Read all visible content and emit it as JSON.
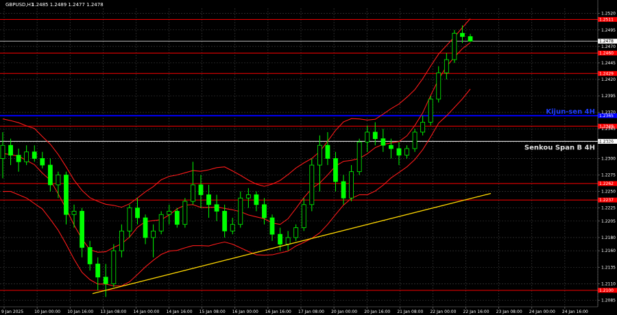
{
  "header": {
    "symbol": "GBPUSD,H1",
    "ohlc": "1.2485 1.2489 1.2477 1.2478"
  },
  "chart_data": {
    "type": "candlestick",
    "symbol": "GBPUSD",
    "timeframe": "H1",
    "ylim": [
      1.2075,
      1.2528
    ],
    "y_ticks": [
      "1.2520",
      "1.2495",
      "1.2470",
      "1.2445",
      "1.2420",
      "1.2395",
      "1.2370",
      "1.2345",
      "1.2325",
      "1.2300",
      "1.2275",
      "1.2250",
      "1.2225",
      "1.2205",
      "1.2180",
      "1.2160",
      "1.2135",
      "1.2110",
      "1.2085"
    ],
    "x_tick_labels": [
      "9 Jan 2025",
      "10 Jan 00:00",
      "10 Jan 16:00",
      "13 Jan 08:00",
      "14 Jan 00:00",
      "14 Jan 16:00",
      "15 Jan 08:00",
      "16 Jan 00:00",
      "16 Jan 16:00",
      "17 Jan 08:00",
      "20 Jan 00:00",
      "20 Jan 16:00",
      "21 Jan 08:00",
      "22 Jan 00:00",
      "22 Jan 16:00",
      "23 Jan 08:00",
      "24 Jan 00:00",
      "24 Jan 16:00"
    ],
    "levels": [
      {
        "value": 1.2511,
        "label": "1.2511",
        "color": "#ff0000"
      },
      {
        "value": 1.2478,
        "label": "1.2478",
        "color": "#ffffff",
        "role": "current price"
      },
      {
        "value": 1.246,
        "label": "1.2460",
        "color": "#ff0000"
      },
      {
        "value": 1.2429,
        "label": "1.2429",
        "color": "#ff0000"
      },
      {
        "value": 1.2349,
        "label": "1.2349",
        "color": "#ff0000"
      },
      {
        "value": 1.2326,
        "label": "1.2326",
        "color": "#ffffff",
        "annotation": "Senkou Span B 4H"
      },
      {
        "value": 1.2365,
        "label": "1.2365",
        "color": "#0000ff",
        "annotation": "Kijun-sen 4H"
      },
      {
        "value": 1.2262,
        "label": "1.2262",
        "color": "#ff0000"
      },
      {
        "value": 1.2237,
        "label": "1.2237",
        "color": "#ff0000"
      },
      {
        "value": 1.21,
        "label": "1.2100",
        "color": "#ff0000"
      }
    ],
    "trendline": {
      "start": 1.2095,
      "end": 1.2247,
      "color": "#ffd700"
    },
    "candles": [
      [
        1.23,
        1.234,
        1.227,
        1.232
      ],
      [
        1.232,
        1.233,
        1.229,
        1.2305
      ],
      [
        1.2305,
        1.2315,
        1.228,
        1.2295
      ],
      [
        1.2295,
        1.232,
        1.229,
        1.231
      ],
      [
        1.231,
        1.232,
        1.2295,
        1.23
      ],
      [
        1.23,
        1.231,
        1.2285,
        1.229
      ],
      [
        1.229,
        1.23,
        1.225,
        1.226
      ],
      [
        1.226,
        1.228,
        1.224,
        1.2275
      ],
      [
        1.2275,
        1.228,
        1.22,
        1.2215
      ],
      [
        1.2215,
        1.223,
        1.2195,
        1.222
      ],
      [
        1.222,
        1.2225,
        1.215,
        1.2165
      ],
      [
        1.2165,
        1.2175,
        1.213,
        1.214
      ],
      [
        1.214,
        1.215,
        1.21,
        1.212
      ],
      [
        1.212,
        1.214,
        1.209,
        1.211
      ],
      [
        1.211,
        1.217,
        1.2105,
        1.216
      ],
      [
        1.216,
        1.22,
        1.215,
        1.219
      ],
      [
        1.219,
        1.223,
        1.218,
        1.2225
      ],
      [
        1.2225,
        1.224,
        1.22,
        1.221
      ],
      [
        1.221,
        1.2215,
        1.217,
        1.218
      ],
      [
        1.218,
        1.22,
        1.215,
        1.219
      ],
      [
        1.219,
        1.222,
        1.2185,
        1.2215
      ],
      [
        1.2215,
        1.223,
        1.22,
        1.222
      ],
      [
        1.222,
        1.2225,
        1.2195,
        1.22
      ],
      [
        1.22,
        1.224,
        1.2195,
        1.2235
      ],
      [
        1.2235,
        1.2295,
        1.223,
        1.226
      ],
      [
        1.226,
        1.2275,
        1.2225,
        1.2245
      ],
      [
        1.2245,
        1.226,
        1.221,
        1.223
      ],
      [
        1.223,
        1.2245,
        1.2205,
        1.222
      ],
      [
        1.222,
        1.223,
        1.218,
        1.219
      ],
      [
        1.219,
        1.221,
        1.2185,
        1.22
      ],
      [
        1.22,
        1.225,
        1.2195,
        1.224
      ],
      [
        1.224,
        1.2255,
        1.2225,
        1.2245
      ],
      [
        1.2245,
        1.225,
        1.222,
        1.223
      ],
      [
        1.223,
        1.224,
        1.22,
        1.221
      ],
      [
        1.221,
        1.2215,
        1.2175,
        1.2185
      ],
      [
        1.2185,
        1.2195,
        1.216,
        1.217
      ],
      [
        1.217,
        1.219,
        1.216,
        1.218
      ],
      [
        1.218,
        1.22,
        1.2175,
        1.2195
      ],
      [
        1.2195,
        1.224,
        1.219,
        1.223
      ],
      [
        1.223,
        1.23,
        1.222,
        1.229
      ],
      [
        1.229,
        1.2335,
        1.225,
        1.232
      ],
      [
        1.232,
        1.234,
        1.229,
        1.23
      ],
      [
        1.23,
        1.231,
        1.225,
        1.2265
      ],
      [
        1.2265,
        1.2275,
        1.223,
        1.224
      ],
      [
        1.224,
        1.229,
        1.2235,
        1.228
      ],
      [
        1.228,
        1.233,
        1.2275,
        1.2325
      ],
      [
        1.2325,
        1.235,
        1.231,
        1.234
      ],
      [
        1.234,
        1.2355,
        1.232,
        1.233
      ],
      [
        1.233,
        1.2345,
        1.231,
        1.232
      ],
      [
        1.232,
        1.233,
        1.23,
        1.2315
      ],
      [
        1.2315,
        1.2325,
        1.229,
        1.2305
      ],
      [
        1.2305,
        1.232,
        1.23,
        1.2315
      ],
      [
        1.2315,
        1.2345,
        1.231,
        1.234
      ],
      [
        1.234,
        1.2365,
        1.2335,
        1.2355
      ],
      [
        1.2355,
        1.2395,
        1.235,
        1.239
      ],
      [
        1.239,
        1.244,
        1.2385,
        1.243
      ],
      [
        1.243,
        1.246,
        1.242,
        1.245
      ],
      [
        1.245,
        1.2495,
        1.2445,
        1.249
      ],
      [
        1.249,
        1.2502,
        1.2475,
        1.2485
      ],
      [
        1.2485,
        1.2489,
        1.2477,
        1.2478
      ]
    ]
  }
}
